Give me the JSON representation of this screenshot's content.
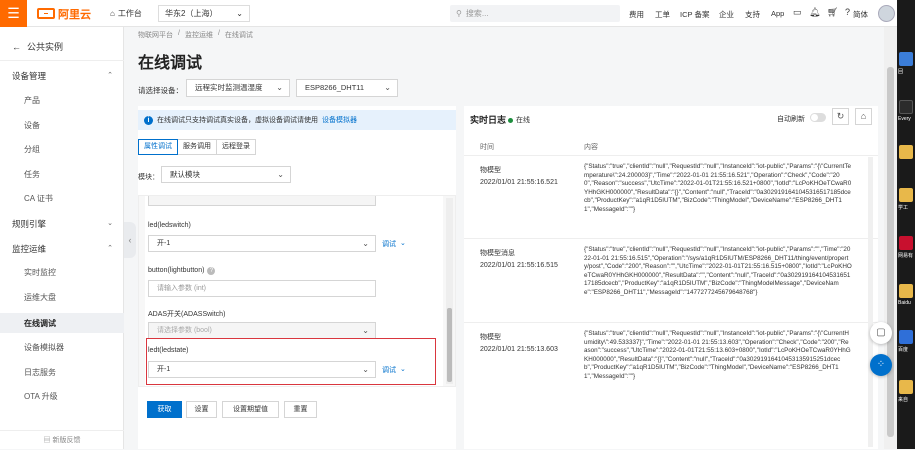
{
  "topbar": {
    "logo_text": "阿里云",
    "workbench": "工作台",
    "region": "华东2（上海）",
    "search_placeholder": "搜索...",
    "links": [
      "费用",
      "工单",
      "ICP 备案",
      "企业",
      "支持",
      "App"
    ],
    "lang": "简体"
  },
  "sidebar": {
    "back": "公共实例",
    "groups": [
      {
        "label": "设备管理",
        "items": [
          "产品",
          "设备",
          "分组",
          "任务",
          "CA 证书"
        ]
      },
      {
        "label": "规则引擎",
        "items": []
      },
      {
        "label": "监控运维",
        "items": [
          "实时监控",
          "运维大盘",
          "在线调试",
          "设备模拟器",
          "日志服务",
          "OTA 升级"
        ]
      }
    ],
    "feedback": "新版反馈"
  },
  "breadcrumb": [
    "物联网平台",
    "/",
    "监控运维",
    "/",
    "在线调试"
  ],
  "page_title": "在线调试",
  "device": {
    "label": "请选择设备：",
    "product": "远程实时监测温湿度",
    "device": "ESP8266_DHT11"
  },
  "info": {
    "text": "在线调试只支持调试真实设备，虚拟设备调试请使用",
    "link": "设备模拟器"
  },
  "tabs": [
    "属性调试",
    "服务调用",
    "远程登录"
  ],
  "module": {
    "label": "模块：",
    "value": "默认模块"
  },
  "fields": [
    {
      "label": "led(ledswitch)",
      "value": "开-1",
      "type": "select",
      "debug": "调试"
    },
    {
      "label": "button(lightbutton)",
      "value": "请输入参数 (int)",
      "type": "input"
    },
    {
      "label": "ADAS开关(ADASSwitch)",
      "value": "请选择参数 (bool)",
      "type": "disabled"
    },
    {
      "label": "ledt(ledstate)",
      "value": "开-1",
      "type": "select",
      "debug": "调试"
    }
  ],
  "buttons": [
    "获取",
    "设置",
    "设置期望值",
    "重置"
  ],
  "log": {
    "title": "实时日志",
    "status": "在线",
    "auto_refresh": "自动刷新",
    "col_time": "时间",
    "col_content": "内容",
    "rows": [
      {
        "type": "物模型",
        "time": "2022/01/01 21:55:16.521",
        "content": "{\"Status\":\"true\",\"clientId\":\"null\",\"RequestId\":\"null\",\"InstanceId\":\"iot-public\",\"Params\":\"{\\\"CurrentTemperature\\\":24.200003}\",\"Time\":\"2022-01-01 21:55:16.521\",\"Operation\":\"Check\",\"Code\":\"200\",\"Reason\":\"success\",\"UtcTime\":\"2022-01-01T21:55:16.521+0800\",\"IotId\":\"LcPoKHOeTCwaR0YHhGKH000000\",\"ResultData\":\"{}\",\"Content\":\"null\",\"TraceId\":\"0a3029191641045316517185dcecb\",\"ProductKey\":\"a1qR1D5IUTM\",\"BizCode\":\"ThingModel\",\"DeviceName\":\"ESP8266_DHT11\",\"MessageId\":\"\"}"
      },
      {
        "type": "物模型消息",
        "time": "2022/01/01 21:55:16.515",
        "content": "{\"Status\":\"true\",\"clientId\":\"null\",\"RequestId\":\"null\",\"InstanceId\":\"iot-public\",\"Params\":\"\",\"Time\":\"2022-01-01 21:55:16.515\",\"Operation\":\"/sys/a1qR1D5IUTM/ESP8266_DHT11/thing/event/property/post\",\"Code\":\"200\",\"Reason\":\"\",\"UtcTime\":\"2022-01-01T21:55:16.515+0800\",\"IotId\":\"LcPoKHOeTCwaR0YHhGKH000000\",\"ResultData\":\"\",\"Content\":\"null\",\"TraceId\":\"0a30291916410453165117185dcecb\",\"ProductKey\":\"a1qR1D5IUTM\",\"BizCode\":\"ThingModelMessage\",\"DeviceName\":\"ESP8266_DHT11\",\"MessageId\":\"1477277245679648768\"}"
      },
      {
        "type": "物模型",
        "time": "2022/01/01 21:55:13.603",
        "content": "{\"Status\":\"true\",\"clientId\":\"null\",\"RequestId\":\"null\",\"InstanceId\":\"iot-public\",\"Params\":\"{\\\"CurrentHumidity\\\":49.533337}\",\"Time\":\"2022-01-01 21:55:13.603\",\"Operation\":\"Check\",\"Code\":\"200\",\"Reason\":\"success\",\"UtcTime\":\"2022-01-01T21:55:13.603+0800\",\"IotId\":\"LcPoKHOeTCwaR0YHhGKH000000\",\"ResultData\":\"{}\",\"Content\":\"null\",\"TraceId\":\"0a30291916410453135915251dcecb\",\"ProductKey\":\"a1qR1D5IUTM\",\"BizCode\":\"ThingModel\",\"DeviceName\":\"ESP8266_DHT11\",\"MessageId\":\"\"}"
      }
    ]
  },
  "desktop_labels": [
    "回",
    "Every",
    "学工",
    "网易有",
    "Baidu",
    "百度",
    "来自"
  ],
  "colors": {
    "brand": "#ff6a00",
    "primary": "#0070cc",
    "highlight": "#d9363e",
    "online": "#1e8e3e"
  }
}
